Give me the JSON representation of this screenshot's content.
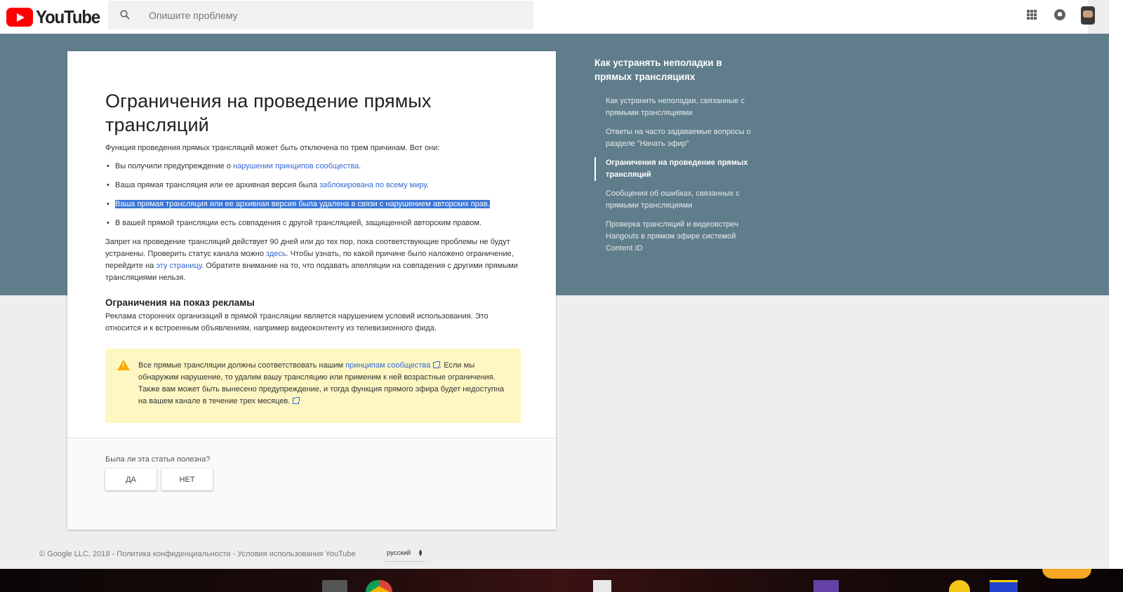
{
  "header": {
    "logo_text": "YouTube",
    "search_placeholder": "Опишите проблему"
  },
  "article": {
    "title": "Ограничения на проведение прямых трансляций",
    "intro": "Функция проведения прямых трансляций может быть отключена по трем причинам. Вот они:",
    "reasons": [
      {
        "text": "Вы получили предупреждение о ",
        "link": "нарушении принципов сообщества",
        "suffix": "."
      },
      {
        "text": "Ваша прямая трансляция или ее архивная версия была ",
        "link": "заблокирована по всему миру",
        "suffix": "."
      },
      {
        "text": "Ваша прямая трансляция или ее архивная версия была удалена в связи с нарушением авторских прав."
      },
      {
        "text": "В вашей прямой трансляции есть совпадения с другой трансляцией, защищенной авторским правом."
      }
    ],
    "ban_p1": "Запрет на проведение трансляций действует 90 дней или до тех пор, пока соответствующие проблемы не будут устранены. Проверить статус канала можно ",
    "ban_link1": "здесь",
    "ban_p2": ". Чтобы узнать, по какой причине было наложено ограничение, перейдите на ",
    "ban_link2": "эту страницу",
    "ban_p3": ". Обратите внимание на то, что подавать апелляции на совпадения с другими прямыми трансляциями нельзя.",
    "ads_title": "Ограничения на показ рекламы",
    "ads_text": "Реклама сторонних организаций в прямой трансляции является нарушением условий использования. Это относится и к встроенным объявлениям, например видеоконтенту из телевизионного фида.",
    "warning_p1": "Все прямые трансляции должны соответствовать нашим ",
    "warning_link": "принципам сообщества",
    "warning_p2": ". Если мы обнаружим нарушение, то удалим вашу трансляцию или применим к ней возрастные ограничения. Также вам может быть вынесено предупреждение, и тогда функция прямого эфира будет недоступна на вашем канале в течение трех месяцев."
  },
  "feedback": {
    "question": "Была ли эта статья полезна?",
    "yes_label": "ДА",
    "no_label": "НЕТ"
  },
  "sidebar": {
    "title": "Как устранять неполадки в прямых трансляциях",
    "items": [
      {
        "label": "Как устранить неполадки, связанные с прямыми трансляциями",
        "active": false
      },
      {
        "label": "Ответы на часто задаваемые вопросы о разделе \"Начать эфир\"",
        "active": false
      },
      {
        "label": "Ограничения на проведение прямых трансляций",
        "active": true
      },
      {
        "label": "Сообщения об ошибках, связанных с прямыми трансляциями",
        "active": false
      },
      {
        "label": "Проверка трансляций и видеовстреч Hangouts в прямом эфире системой Content ID",
        "active": false
      }
    ]
  },
  "footer": {
    "text": "© Google LLC, 2018 - Политика конфиденциальности - Условия использования YouTube",
    "language": "русский"
  },
  "colors": {
    "hero": "#607d8b",
    "link": "#3367d6",
    "warning_bg": "#fef7c3",
    "highlight": "#3b76d6"
  }
}
